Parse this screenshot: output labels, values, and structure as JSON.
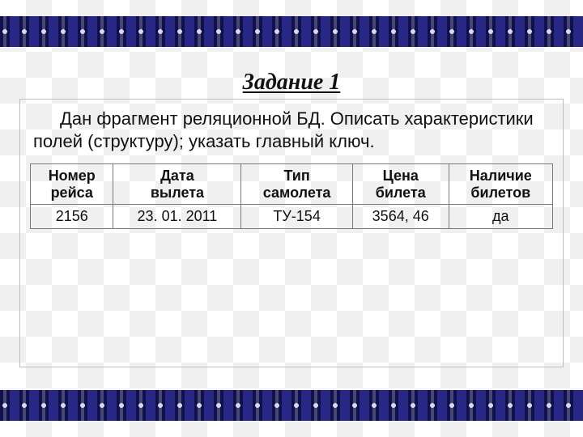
{
  "title": "Задание 1",
  "body_text": "Дан фрагмент реляционной БД. Описать характеристики полей (структуру); указать главный ключ.",
  "table": {
    "headers": [
      "Номер\nрейса",
      "Дата\nвылета",
      "Тип\nсамолета",
      "Цена\nбилета",
      "Наличие\nбилетов"
    ],
    "rows": [
      [
        "2156",
        "23. 01. 2011",
        "ТУ-154",
        "3564, 46",
        "да"
      ]
    ]
  }
}
